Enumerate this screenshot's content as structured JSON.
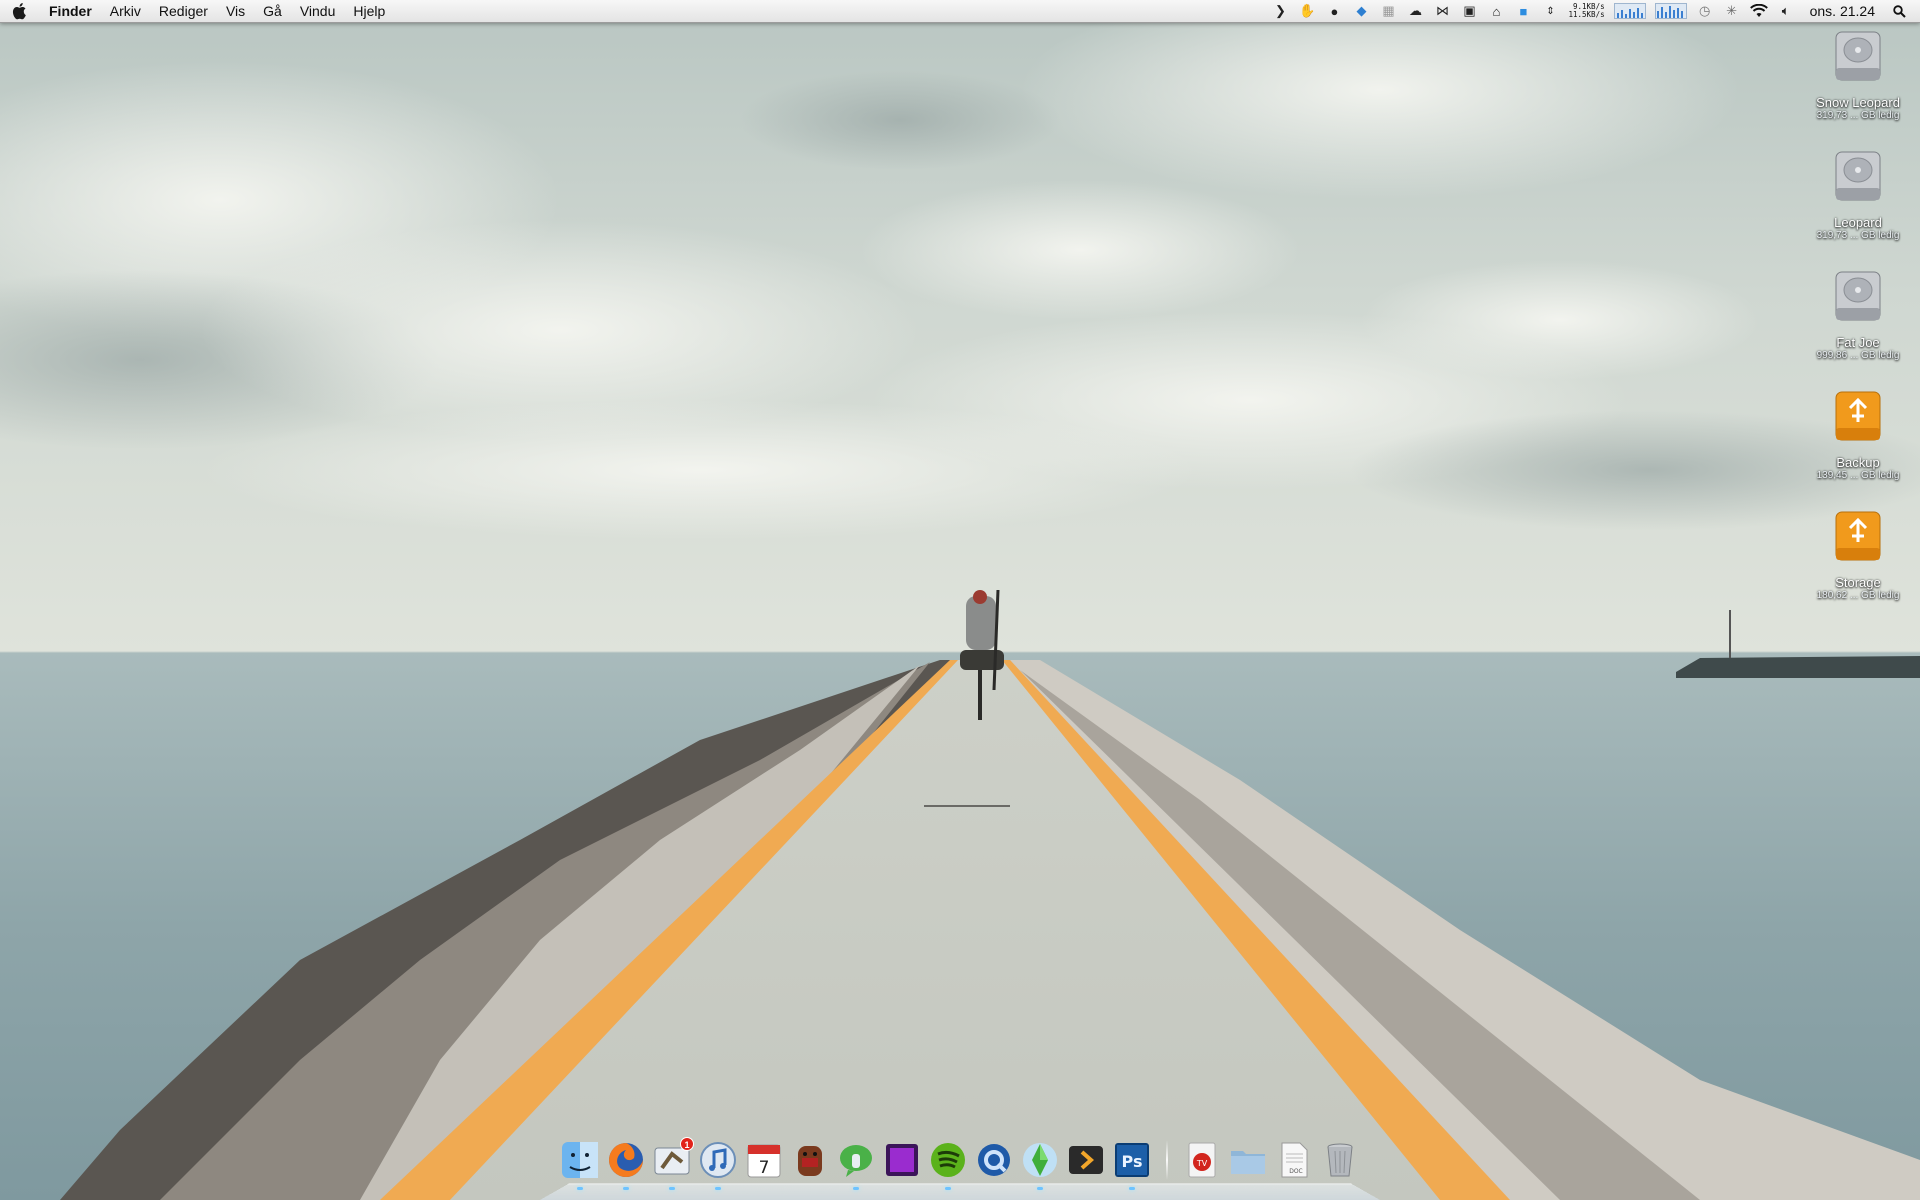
{
  "menubar": {
    "apple_icon": "apple-logo-icon",
    "app_name": "Finder",
    "menus": [
      "Arkiv",
      "Rediger",
      "Vis",
      "Gå",
      "Vindu",
      "Hjelp"
    ],
    "status_icons": [
      "chevron-right-icon",
      "hand-icon",
      "robot-icon",
      "dropbox-icon",
      "grid-icon",
      "cloud-icon",
      "butterfly-icon",
      "gift-icon",
      "bell-icon",
      "window-icon",
      "updown-arrow-icon"
    ],
    "network_up": "9.1KB/s",
    "network_down": "11.5KB/s",
    "status_icons_right": [
      "time-machine-icon",
      "bluetooth-icon",
      "wifi-icon",
      "volume-icon"
    ],
    "clock": "ons. 21.24",
    "spotlight_icon": "spotlight-icon"
  },
  "desktop_icons": [
    {
      "name": "Snow Leopard",
      "info": "319,73 ... GB ledig",
      "type": "hard-drive"
    },
    {
      "name": "Leopard",
      "info": "319,73 ... GB ledig",
      "type": "hard-drive"
    },
    {
      "name": "Fat Joe",
      "info": "999,86 ... GB ledig",
      "type": "hard-drive"
    },
    {
      "name": "Backup",
      "info": "139,45 ... GB ledig",
      "type": "firewire-drive"
    },
    {
      "name": "Storage",
      "info": "180,62 ... GB ledig",
      "type": "firewire-drive"
    }
  ],
  "dock": {
    "apps": [
      "Finder",
      "Firefox",
      "Mail",
      "iTunes",
      "iCal",
      "Domo",
      "Adium",
      "Quartz",
      "Spotify",
      "QuickTime",
      "The Sims",
      "Plex",
      "Photoshop"
    ],
    "mail_badge": "1",
    "ical_date": "7",
    "photoshop_label": "Ps",
    "doc_label": "DOC",
    "others": [
      "TV",
      "Folder",
      "Document",
      "Trash"
    ]
  },
  "colors": {
    "road_stripe": "#f2ad55",
    "menubar": "#eeeeee",
    "dock_indicator": "#6ec3ff"
  }
}
